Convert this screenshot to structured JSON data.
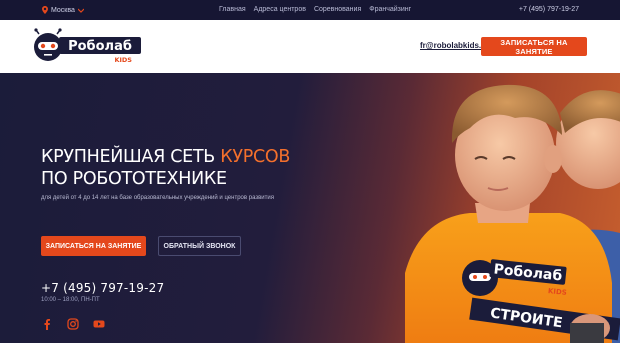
{
  "topbar": {
    "city": "Москва",
    "nav": [
      "Главная",
      "Адреса центров",
      "Соревнования",
      "Франчайзинг"
    ],
    "phone": "+7 (495) 797-19-27"
  },
  "header": {
    "logo_text": "Роболаб",
    "logo_sub": "KIDS",
    "email": "fr@robolabkids.ru",
    "cta": "ЗАПИСАТЬСЯ НА ЗАНЯТИЕ"
  },
  "hero": {
    "title_part1": "КРУПНЕЙШАЯ СЕТЬ",
    "title_accent": "КУРСОВ",
    "title_line2": "ПО РОБОТОТЕХНИКЕ",
    "subtitle": "для детей от 4 до 14 лет на базе образовательных учреждений и центров развития",
    "primary_button": "ЗАПИСАТЬСЯ НА ЗАНЯТИЕ",
    "secondary_button": "ОБРАТНЫЙ ЗВОНОК",
    "phone": "+7 (495) 797-19-27",
    "hours": "10:00 – 18:00, ПН-ПТ",
    "shirt_text": "Роболаб",
    "shirt_sub": "KIDS",
    "shirt_band": "СТРОИТЕ",
    "socials": [
      "facebook-icon",
      "instagram-icon",
      "youtube-icon"
    ]
  },
  "colors": {
    "accent": "#e4481c",
    "navy": "#1b1c3a",
    "orange_text": "#f4702c"
  }
}
